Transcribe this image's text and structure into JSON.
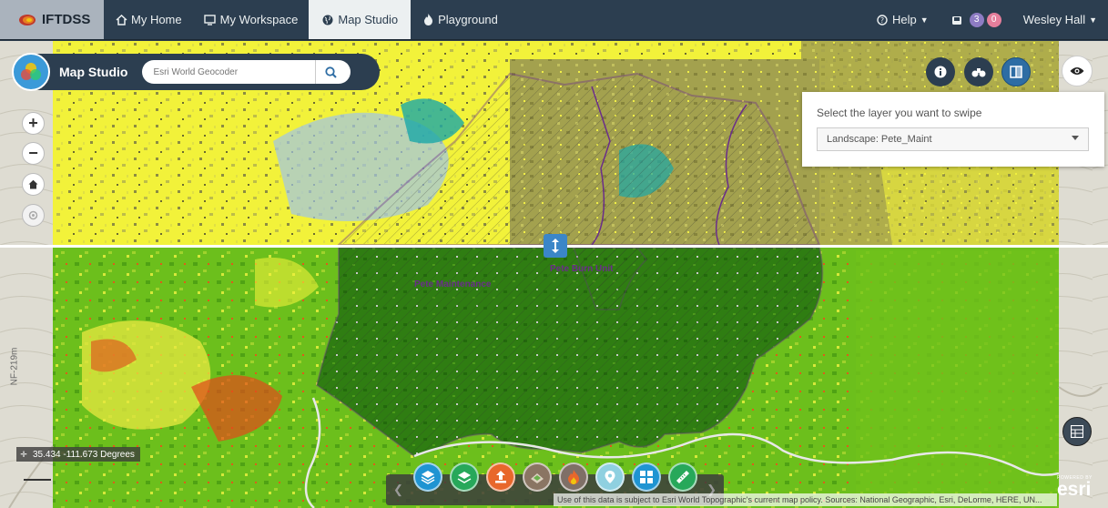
{
  "navbar": {
    "brand": "IFTDSS",
    "items": [
      {
        "label": "My Home",
        "icon": "home-icon"
      },
      {
        "label": "My Workspace",
        "icon": "monitor-icon"
      },
      {
        "label": "Map Studio",
        "icon": "globe-icon",
        "active": true
      },
      {
        "label": "Playground",
        "icon": "fire-icon"
      }
    ],
    "help": "Help",
    "notifications": {
      "count_purple": "3",
      "count_pink": "0"
    },
    "user": "Wesley Hall"
  },
  "studio": {
    "title": "Map Studio",
    "search_placeholder": "Esri World Geocoder"
  },
  "swipe": {
    "prompt": "Select the layer you want to swipe",
    "selected_layer": "Landscape: Pete_Maint"
  },
  "map": {
    "labels": {
      "maintenance": "Pete Maintenance",
      "burn_unit": "Pete Burn Unit",
      "road": "NF-219m"
    },
    "coordinates": "35.434 -111.673 Degrees",
    "attribution": "Use of this data is subject to Esri World Topographic's current map policy. Sources: National Geographic, Esri, DeLorme, HERE, UN...",
    "powered_by": "POWERED BY",
    "esri": "esri"
  },
  "colors": {
    "navbar": "#2c3e50",
    "accent": "#3b86c8",
    "upper_layer": "#f5f53a",
    "lower_layer": "#2f7d12",
    "polygon": "#6a2d8a"
  }
}
